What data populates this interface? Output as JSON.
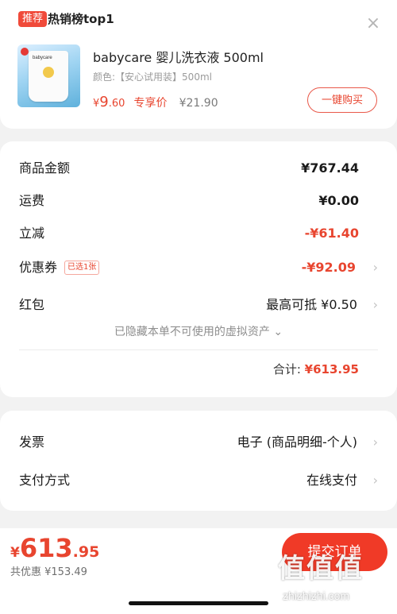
{
  "promo": {
    "badge": "推荐",
    "title": "热销榜top1",
    "product": {
      "thumbnail_brand": "babycare",
      "name": "babycare 婴儿洗衣液 500ml",
      "spec": "颜色:【安心试用装】500ml",
      "price_currency": "¥",
      "price_int": "9",
      "price_dec": ".60",
      "price_tag": "专享价",
      "original_price": "¥21.90",
      "buy_label": "一键购买"
    }
  },
  "summary": {
    "goods_label": "商品金额",
    "goods_value": "¥767.44",
    "shipping_label": "运费",
    "shipping_value": "¥0.00",
    "discount_label": "立减",
    "discount_value": "-¥61.40",
    "coupon_label": "优惠券",
    "coupon_tag": "已选1张",
    "coupon_value": "-¥92.09",
    "redpacket_label": "红包",
    "redpacket_value": "最高可抵 ¥0.50",
    "hidden_note": "已隐藏本单不可使用的虚拟资产",
    "total_label": "合计:",
    "total_value": "¥613.95"
  },
  "invoice": {
    "invoice_label": "发票",
    "invoice_value": "电子 (商品明细-个人)",
    "payment_label": "支付方式",
    "payment_value": "在线支付"
  },
  "bottom": {
    "currency": "¥",
    "price_int": "613",
    "price_dec": ".95",
    "saved": "共优惠 ¥153.49",
    "submit_label": "提交订单"
  },
  "watermark": {
    "text": "值值值",
    "site": "zhizhizhi.com"
  },
  "colors": {
    "accent": "#e8452f",
    "button": "#f03a27",
    "background": "#f2f2f2"
  },
  "icons": {
    "close": "close-icon",
    "chevron": "chevron-right-icon",
    "expand": "chevron-down-icon"
  }
}
